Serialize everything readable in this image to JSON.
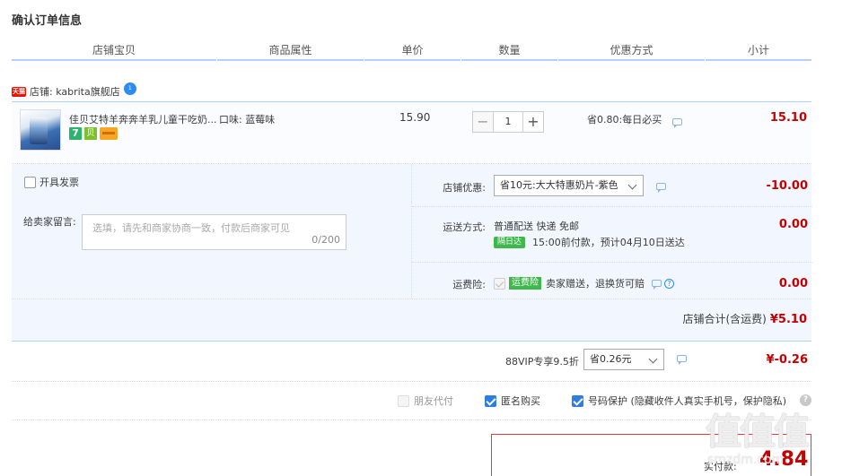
{
  "page_title": "确认订单信息",
  "columns": [
    "店铺宝贝",
    "商品属性",
    "单价",
    "数量",
    "优惠方式",
    "小计"
  ],
  "shop": {
    "badge": "天猫",
    "label": "店铺: kabrita旗舰店",
    "ww_badge": "1"
  },
  "product": {
    "name": "佳贝艾特羊奔奔羊乳儿童干吃奶...",
    "attr": "口味: 蓝莓味",
    "icon_7": "7",
    "icon_g": "贝",
    "price": "15.90",
    "qty_minus": "−",
    "qty_value": "1",
    "qty_plus": "+",
    "discount": "省0.80:每日必买",
    "subtotal": "15.10"
  },
  "invoice": {
    "label": "开具发票"
  },
  "message": {
    "label": "给卖家留言:",
    "placeholder": "选填，请先和商家协商一致，付款后商家可见",
    "count": "0/200"
  },
  "shop_discount": {
    "label": "店铺优惠:",
    "selected": "省10元:大大特惠奶片-紫色",
    "amount": "-10.00"
  },
  "shipping": {
    "label": "运送方式:",
    "text": "普通配送 快递 免邮",
    "tag": "隔日达",
    "sub": "15:00前付款，预计04月10日送达",
    "amount": "0.00"
  },
  "insurance": {
    "label": "运费险:",
    "tag": "运费险",
    "text": "卖家赠送，退换货可赔",
    "help": "?",
    "amount": "0.00"
  },
  "shop_total": {
    "label": "店铺合计(含运费)",
    "amount": "¥5.10"
  },
  "vip": {
    "label": "88VIP专享9.5折",
    "selected": "省0.26元",
    "amount": "¥-0.26"
  },
  "options": {
    "friend_pay": "朋友代付",
    "anonymous": "匿名购买",
    "number_protect": "号码保护 (隐藏收件人真实手机号，保护隐私)",
    "help": "?"
  },
  "pay": {
    "label": "实付款:",
    "amount": "4.84"
  },
  "watermark": {
    "text": "值值值",
    "url": "smzdm.com"
  },
  "colors": {
    "accent": "#c40000",
    "border_blue": "#b2d1ff",
    "panel_bg": "#f2f7ff",
    "checkbox_blue": "#2d7ee0",
    "tag_green": "#3eb74b"
  }
}
